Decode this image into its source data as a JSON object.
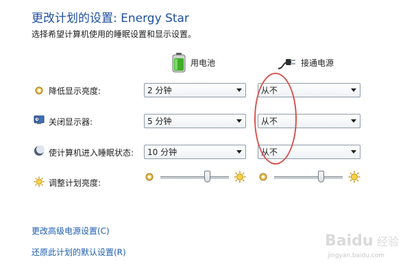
{
  "title": "更改计划的设置: Energy Star",
  "subtitle": "选择希望计算机使用的睡眠设置和显示设置。",
  "columns": {
    "battery": "用电池",
    "plugged": "接通电源"
  },
  "rows": [
    {
      "label": "降低显示亮度:",
      "battery": "2 分钟",
      "plugged": "从不"
    },
    {
      "label": "关闭显示器:",
      "battery": "5 分钟",
      "plugged": "从不"
    },
    {
      "label": "使计算机进入睡眠状态:",
      "battery": "10 分钟",
      "plugged": "从不"
    }
  ],
  "brightness": {
    "label": "调整计划亮度:",
    "battery_level": 0.7,
    "plugged_level": 0.7
  },
  "links": {
    "advanced": "更改高级电源设置(C)",
    "restore": "还原此计划的默认设置(R)"
  },
  "watermark": {
    "logo": "Baidu 经验",
    "url": "jingyan.baidu.com"
  },
  "colors": {
    "title": "#1e4fa0",
    "link": "#1e5eb0",
    "annotation": "#d9534f"
  }
}
